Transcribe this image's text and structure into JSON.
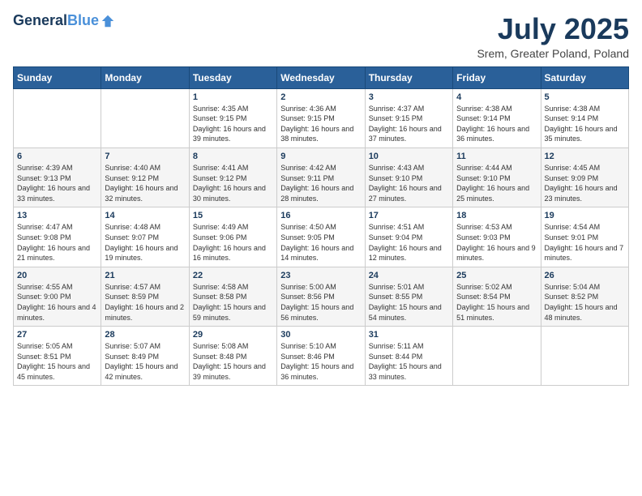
{
  "logo": {
    "line1": "General",
    "line2": "Blue"
  },
  "title": {
    "month_year": "July 2025",
    "location": "Srem, Greater Poland, Poland"
  },
  "calendar": {
    "headers": [
      "Sunday",
      "Monday",
      "Tuesday",
      "Wednesday",
      "Thursday",
      "Friday",
      "Saturday"
    ],
    "weeks": [
      [
        {
          "day": "",
          "info": ""
        },
        {
          "day": "",
          "info": ""
        },
        {
          "day": "1",
          "info": "Sunrise: 4:35 AM\nSunset: 9:15 PM\nDaylight: 16 hours and 39 minutes."
        },
        {
          "day": "2",
          "info": "Sunrise: 4:36 AM\nSunset: 9:15 PM\nDaylight: 16 hours and 38 minutes."
        },
        {
          "day": "3",
          "info": "Sunrise: 4:37 AM\nSunset: 9:15 PM\nDaylight: 16 hours and 37 minutes."
        },
        {
          "day": "4",
          "info": "Sunrise: 4:38 AM\nSunset: 9:14 PM\nDaylight: 16 hours and 36 minutes."
        },
        {
          "day": "5",
          "info": "Sunrise: 4:38 AM\nSunset: 9:14 PM\nDaylight: 16 hours and 35 minutes."
        }
      ],
      [
        {
          "day": "6",
          "info": "Sunrise: 4:39 AM\nSunset: 9:13 PM\nDaylight: 16 hours and 33 minutes."
        },
        {
          "day": "7",
          "info": "Sunrise: 4:40 AM\nSunset: 9:12 PM\nDaylight: 16 hours and 32 minutes."
        },
        {
          "day": "8",
          "info": "Sunrise: 4:41 AM\nSunset: 9:12 PM\nDaylight: 16 hours and 30 minutes."
        },
        {
          "day": "9",
          "info": "Sunrise: 4:42 AM\nSunset: 9:11 PM\nDaylight: 16 hours and 28 minutes."
        },
        {
          "day": "10",
          "info": "Sunrise: 4:43 AM\nSunset: 9:10 PM\nDaylight: 16 hours and 27 minutes."
        },
        {
          "day": "11",
          "info": "Sunrise: 4:44 AM\nSunset: 9:10 PM\nDaylight: 16 hours and 25 minutes."
        },
        {
          "day": "12",
          "info": "Sunrise: 4:45 AM\nSunset: 9:09 PM\nDaylight: 16 hours and 23 minutes."
        }
      ],
      [
        {
          "day": "13",
          "info": "Sunrise: 4:47 AM\nSunset: 9:08 PM\nDaylight: 16 hours and 21 minutes."
        },
        {
          "day": "14",
          "info": "Sunrise: 4:48 AM\nSunset: 9:07 PM\nDaylight: 16 hours and 19 minutes."
        },
        {
          "day": "15",
          "info": "Sunrise: 4:49 AM\nSunset: 9:06 PM\nDaylight: 16 hours and 16 minutes."
        },
        {
          "day": "16",
          "info": "Sunrise: 4:50 AM\nSunset: 9:05 PM\nDaylight: 16 hours and 14 minutes."
        },
        {
          "day": "17",
          "info": "Sunrise: 4:51 AM\nSunset: 9:04 PM\nDaylight: 16 hours and 12 minutes."
        },
        {
          "day": "18",
          "info": "Sunrise: 4:53 AM\nSunset: 9:03 PM\nDaylight: 16 hours and 9 minutes."
        },
        {
          "day": "19",
          "info": "Sunrise: 4:54 AM\nSunset: 9:01 PM\nDaylight: 16 hours and 7 minutes."
        }
      ],
      [
        {
          "day": "20",
          "info": "Sunrise: 4:55 AM\nSunset: 9:00 PM\nDaylight: 16 hours and 4 minutes."
        },
        {
          "day": "21",
          "info": "Sunrise: 4:57 AM\nSunset: 8:59 PM\nDaylight: 16 hours and 2 minutes."
        },
        {
          "day": "22",
          "info": "Sunrise: 4:58 AM\nSunset: 8:58 PM\nDaylight: 15 hours and 59 minutes."
        },
        {
          "day": "23",
          "info": "Sunrise: 5:00 AM\nSunset: 8:56 PM\nDaylight: 15 hours and 56 minutes."
        },
        {
          "day": "24",
          "info": "Sunrise: 5:01 AM\nSunset: 8:55 PM\nDaylight: 15 hours and 54 minutes."
        },
        {
          "day": "25",
          "info": "Sunrise: 5:02 AM\nSunset: 8:54 PM\nDaylight: 15 hours and 51 minutes."
        },
        {
          "day": "26",
          "info": "Sunrise: 5:04 AM\nSunset: 8:52 PM\nDaylight: 15 hours and 48 minutes."
        }
      ],
      [
        {
          "day": "27",
          "info": "Sunrise: 5:05 AM\nSunset: 8:51 PM\nDaylight: 15 hours and 45 minutes."
        },
        {
          "day": "28",
          "info": "Sunrise: 5:07 AM\nSunset: 8:49 PM\nDaylight: 15 hours and 42 minutes."
        },
        {
          "day": "29",
          "info": "Sunrise: 5:08 AM\nSunset: 8:48 PM\nDaylight: 15 hours and 39 minutes."
        },
        {
          "day": "30",
          "info": "Sunrise: 5:10 AM\nSunset: 8:46 PM\nDaylight: 15 hours and 36 minutes."
        },
        {
          "day": "31",
          "info": "Sunrise: 5:11 AM\nSunset: 8:44 PM\nDaylight: 15 hours and 33 minutes."
        },
        {
          "day": "",
          "info": ""
        },
        {
          "day": "",
          "info": ""
        }
      ]
    ]
  }
}
